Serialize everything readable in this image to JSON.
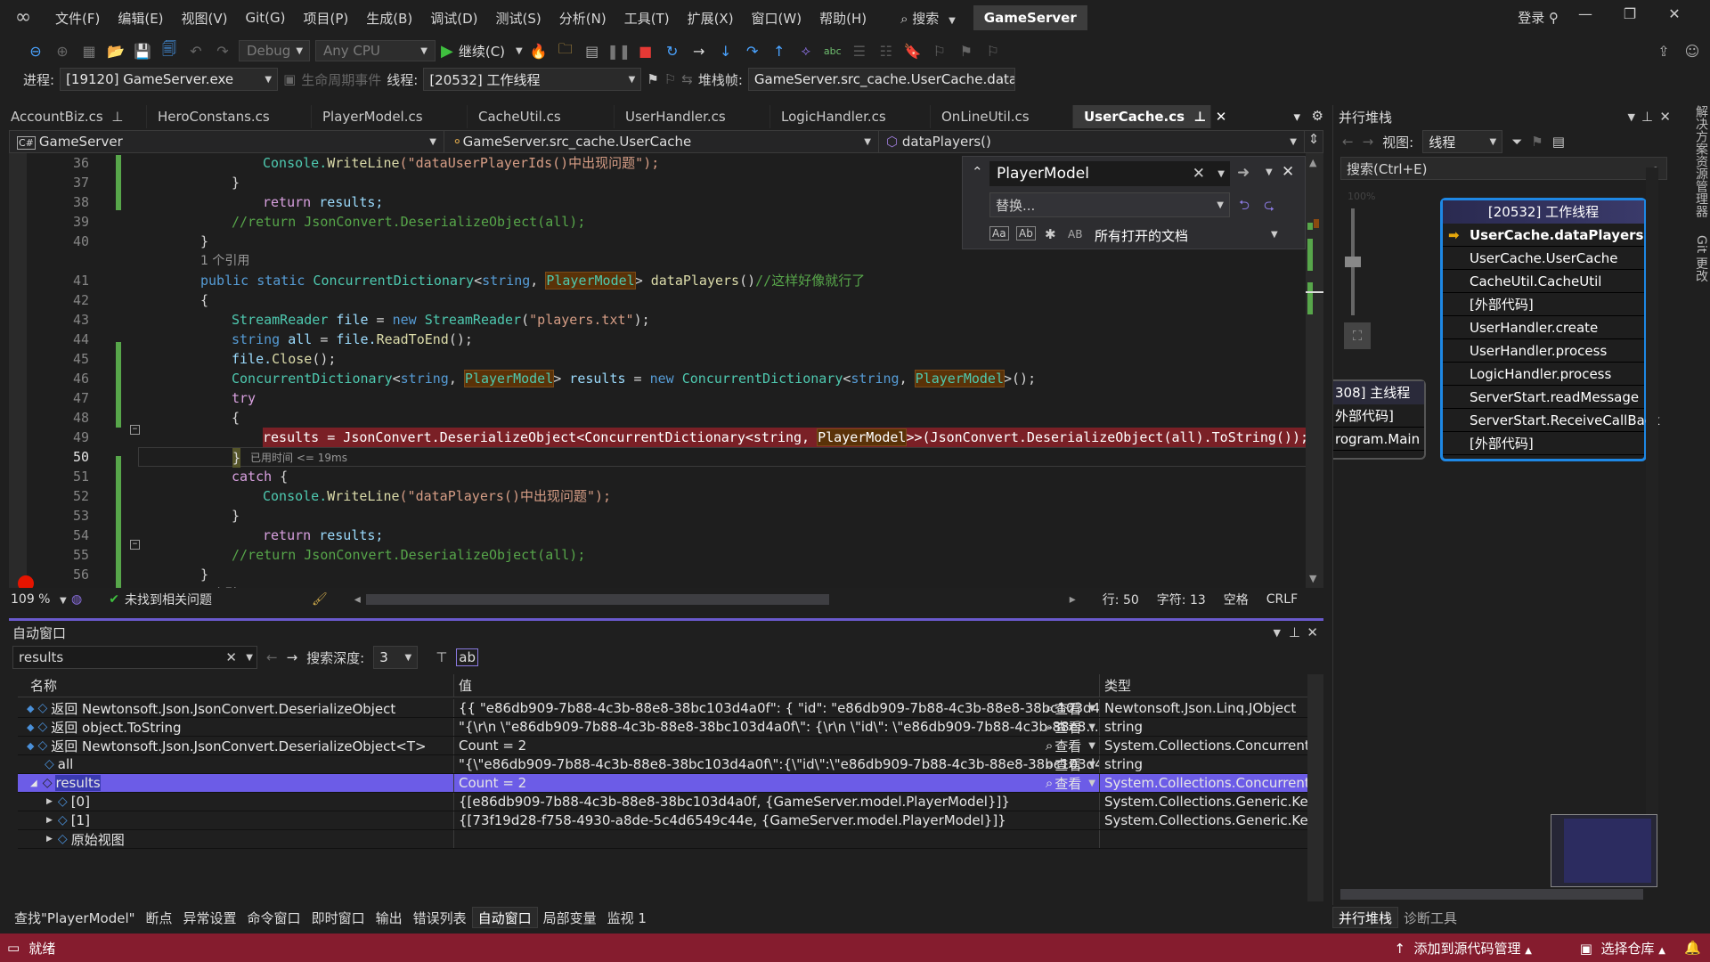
{
  "menubar": {
    "items": [
      "文件(F)",
      "编辑(E)",
      "视图(V)",
      "Git(G)",
      "项目(P)",
      "生成(B)",
      "调试(D)",
      "测试(S)",
      "分析(N)",
      "工具(T)",
      "扩展(X)",
      "窗口(W)",
      "帮助(H)"
    ],
    "search_label": "搜索",
    "solution_name": "GameServer",
    "login_label": "登录"
  },
  "toolbar": {
    "config": "Debug",
    "platform": "Any CPU",
    "continue_label": "继续(C)"
  },
  "debug_location": {
    "process_label": "进程:",
    "process_value": "[19120] GameServer.exe",
    "lifecycle_label": "生命周期事件",
    "thread_label": "线程:",
    "thread_value": "[20532] 工作线程",
    "stackframe_label": "堆栈帧:",
    "stackframe_value": "GameServer.src_cache.UserCache.data"
  },
  "doc_tabs": [
    {
      "label": "AccountBiz.cs",
      "pinned": true,
      "active": false
    },
    {
      "label": "HeroConstans.cs",
      "active": false
    },
    {
      "label": "PlayerModel.cs",
      "active": false
    },
    {
      "label": "CacheUtil.cs",
      "active": false
    },
    {
      "label": "UserHandler.cs",
      "active": false
    },
    {
      "label": "LogicHandler.cs",
      "active": false
    },
    {
      "label": "OnLineUtil.cs",
      "active": false
    },
    {
      "label": "UserCache.cs",
      "active": true
    }
  ],
  "editor": {
    "project": "GameServer",
    "class": "GameServer.src_cache.UserCache",
    "member": "dataPlayers()",
    "zoom": "109 %",
    "issues": "未找到相关问题",
    "line": "行: 50",
    "col": "字符: 13",
    "whitespace": "空格",
    "eol": "CRLF",
    "elapsed": "已用时间 <= 19ms",
    "codelens": "1 个引用",
    "lines": {
      "l36": {
        "num": "36",
        "a": "Console.",
        "b": "WriteLine",
        "c": "(\"dataUserPlayerIds()中出现问题\");"
      },
      "l37": {
        "num": "37",
        "text": "}"
      },
      "l38": {
        "num": "38",
        "kw": "return",
        "rest": " results;"
      },
      "l39": {
        "num": "39",
        "text": "//return JsonConvert.DeserializeObject(all);"
      },
      "l40": {
        "num": "40",
        "text": "}"
      },
      "l41": {
        "num": "41",
        "kw": "public static",
        "type": " ConcurrentDictionary",
        "p1": "<",
        "k2": "string",
        ",": ", ",
        "hl": "PlayerModel",
        "p2": ">",
        "m": " dataPlayers",
        "p3": "()",
        "cm": "//这样好像就行了"
      },
      "l42": {
        "num": "42",
        "text": "{"
      },
      "l43": {
        "num": "43",
        "type": "StreamReader",
        "v": " file",
        " eq": " = ",
        "kw": "new",
        "type2": " StreamReader",
        "p": "(",
        "s": "\"players.txt\"",
        "end": ");"
      },
      "l44": {
        "num": "44",
        "kw": "string",
        "v": " all",
        "eq": " = ",
        "v2": "file.",
        "m": "ReadToEnd",
        "end": "();"
      },
      "l45": {
        "num": "45",
        "v": "file.",
        "m": "Close",
        "end": "();"
      },
      "l46": {
        "num": "46",
        "type": "ConcurrentDictionary",
        "p1": "<",
        "k": "string",
        ",": ", ",
        "hl": "PlayerModel",
        "p2": ">",
        "v": " results",
        "eq": " = ",
        "kw": "new",
        "type2": " ConcurrentDictionary",
        "p3": "<",
        "k2": "string",
        ",2": ", ",
        "hl2": "PlayerModel",
        "end": ">();"
      },
      "l47": {
        "num": "47",
        "kw": "try"
      },
      "l48": {
        "num": "48",
        "text": "{"
      },
      "l49": {
        "num": "49",
        "a": "results = JsonConvert.DeserializeObject<ConcurrentDictionary<string, ",
        "hl": "PlayerModel",
        "b": ">>(JsonConvert.DeserializeObject(all).ToString());"
      },
      "l50": {
        "num": "50",
        "text": "}"
      },
      "l51": {
        "num": "51",
        "kw": "catch",
        "rest": " {"
      },
      "l52": {
        "num": "52",
        "a": "Console.",
        "b": "WriteLine",
        "c": "(\"dataPlayers()中出现问题\");"
      },
      "l53": {
        "num": "53",
        "text": "}"
      },
      "l54": {
        "num": "54",
        "kw": "return",
        "rest": " results;"
      },
      "l55": {
        "num": "55",
        "text": "//return JsonConvert.DeserializeObject(all);"
      },
      "l56": {
        "num": "56",
        "text": "}"
      }
    }
  },
  "find": {
    "query": "PlayerModel",
    "replace_placeholder": "替换...",
    "scope": "所有打开的文档",
    "opt_regex_label": "AB"
  },
  "autos": {
    "title": "自动窗口",
    "search_value": "results",
    "depth_label": "搜索深度:",
    "depth_value": "3",
    "columns": {
      "name": "名称",
      "value": "值",
      "type": "类型"
    },
    "view_label": "查看",
    "rows": [
      {
        "name": "返回 Newtonsoft.Json.JsonConvert.DeserializeObject",
        "value": "{{  \"e86db909-7b88-4c3b-88e8-38bc103d4a0f\": {    \"id\": \"e86db909-7b88-4c3b-88e8-38bc103d4...",
        "type": "Newtonsoft.Json.Linq.JObject"
      },
      {
        "name": "返回 object.ToString",
        "value": "\"{\\r\\n  \\\"e86db909-7b88-4c3b-88e8-38bc103d4a0f\\\": {\\r\\n    \\\"id\\\": \\\"e86db909-7b88-4c3b-88e8...",
        "type": "string"
      },
      {
        "name": "返回 Newtonsoft.Json.JsonConvert.DeserializeObject<T>",
        "value": "Count = 2",
        "type": "System.Collections.Concurrent.Con..."
      },
      {
        "name": "all",
        "value": "\"{\\\"e86db909-7b88-4c3b-88e8-38bc103d4a0f\\\":{\\\"id\\\":\\\"e86db909-7b88-4c3b-88e8-38bc103d4...",
        "type": "string"
      },
      {
        "name": "results",
        "value": "Count = 2",
        "type": "System.Collections.Concurrent.Con..."
      },
      {
        "name": "[0]",
        "value": "{[e86db909-7b88-4c3b-88e8-38bc103d4a0f, {GameServer.model.PlayerModel}]}",
        "type": "System.Collections.Generic.KeyVal..."
      },
      {
        "name": "[1]",
        "value": "{[73f19d28-f758-4930-a8de-5c4d6549c44e, {GameServer.model.PlayerModel}]}",
        "type": "System.Collections.Generic.KeyVal..."
      },
      {
        "name": "原始视图",
        "value": "",
        "type": ""
      }
    ]
  },
  "bottom_tabs": [
    "查找\"PlayerModel\"",
    "断点",
    "异常设置",
    "命令窗口",
    "即时窗口",
    "输出",
    "错误列表",
    "自动窗口",
    "局部变量",
    "监视 1"
  ],
  "parallel_stacks": {
    "title": "并行堆栈",
    "view_label": "视图:",
    "view_value": "线程",
    "search_placeholder": "搜索(Ctrl+E)",
    "zoom": "100%",
    "worker_thread": {
      "header": "[20532] 工作线程",
      "frames": [
        "UserCache.dataPlayers",
        "UserCache.UserCache",
        "CacheUtil.CacheUtil",
        "[外部代码]",
        "UserHandler.create",
        "UserHandler.process",
        "LogicHandler.process",
        "ServerStart.readMessage",
        "ServerStart.ReceiveCallBack",
        "[外部代码]"
      ]
    },
    "main_thread": {
      "header": "308] 主线程",
      "frames": [
        "外部代码]",
        "rogram.Main"
      ]
    },
    "tabs": [
      "并行堆栈",
      "诊断工具"
    ]
  },
  "side_tabs": [
    "解决方案资源管理器",
    "Git 更改"
  ],
  "statusbar": {
    "ready": "就绪",
    "add_source": "添加到源代码管理",
    "select_repo": "选择仓库"
  },
  "colors": {
    "accent": "#6c5ce7",
    "statusbar": "#851c2e",
    "breakpoint": "#e51400",
    "thread_border": "#1e88e5"
  }
}
